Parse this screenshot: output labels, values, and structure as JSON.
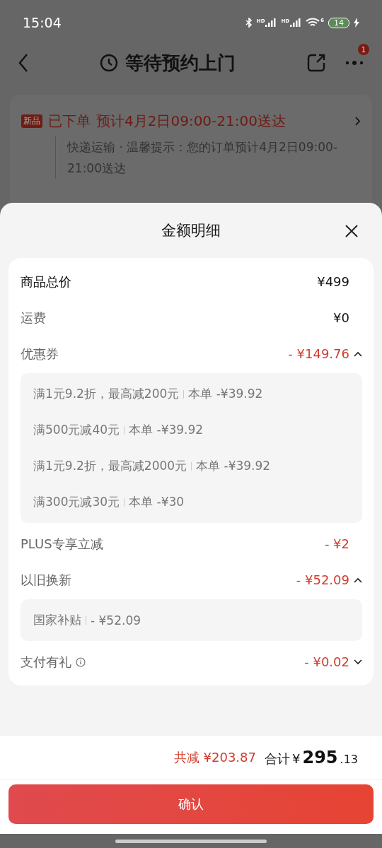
{
  "status_bar": {
    "time": "15:04",
    "signal_labels": [
      "HD",
      "HD"
    ],
    "wifi_label": "6",
    "battery": "14"
  },
  "header": {
    "title": "等待预约上门",
    "badge": "1"
  },
  "order_card": {
    "tag": "新品",
    "status": "已下单",
    "eta": "预计4月2日09:00-21:00送达",
    "note": "快递运输 · 温馨提示：您的订单预计4月2日09:00-21:00送达"
  },
  "sheet": {
    "title": "金额明细",
    "rows": [
      {
        "kind": "price",
        "label": "商品总价",
        "value": "¥499"
      },
      {
        "kind": "fee",
        "label": "运费",
        "value": "¥0"
      },
      {
        "kind": "discount",
        "label": "优惠券",
        "value": "- ¥149.76",
        "expanded": true,
        "details": [
          {
            "condition": "满1元9.2折，最高减200元",
            "amount": "本单 -¥39.92"
          },
          {
            "condition": "满500元减40元",
            "amount": "本单 -¥39.92"
          },
          {
            "condition": "满1元9.2折，最高减2000元",
            "amount": "本单 -¥39.92"
          },
          {
            "condition": "满300元减30元",
            "amount": "本单 -¥30"
          }
        ]
      },
      {
        "kind": "discount",
        "label": "PLUS专享立减",
        "value": "- ¥2"
      },
      {
        "kind": "discount",
        "label": "以旧换新",
        "value": "- ¥52.09",
        "expanded": true,
        "details": [
          {
            "condition": "国家补贴",
            "amount": "- ¥52.09"
          }
        ]
      },
      {
        "kind": "discount",
        "label": "支付有礼",
        "value": "- ¥0.02",
        "expanded": false,
        "info": true
      }
    ],
    "summary": {
      "saved_label": "共减",
      "saved": "¥203.87",
      "total_label": "合计",
      "currency": "¥",
      "total_integer": "295",
      "total_decimal": ".13"
    },
    "confirm": "确认"
  }
}
